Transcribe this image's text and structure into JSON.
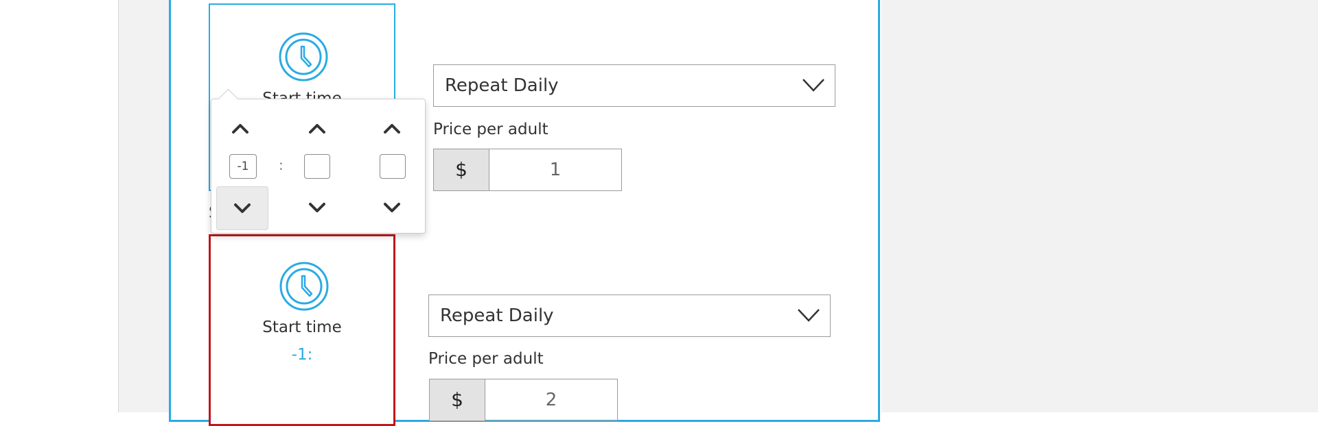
{
  "colors": {
    "accent": "#29abe2",
    "error_border": "#c0161b",
    "panel_border": "#29abe2",
    "page_background": "#f2f2f2"
  },
  "slot_1": {
    "start_label": "Start time",
    "repeat_value": "Repeat Daily",
    "price_label": "Price per adult",
    "currency": "$",
    "price_value": "1",
    "icon": "clock-icon"
  },
  "time_picker": {
    "hours_value": "-1",
    "minutes_value": "",
    "seconds_value": "",
    "separator": ":",
    "icons": {
      "up": "chevron-up-icon",
      "down": "chevron-down-icon"
    }
  },
  "slot_2": {
    "start_label": "Start time",
    "time_value": "-1:",
    "repeat_value": "Repeat Daily",
    "price_label": "Price per adult",
    "currency": "$",
    "price_value": "2",
    "icon": "clock-icon"
  },
  "stray_text": "S"
}
